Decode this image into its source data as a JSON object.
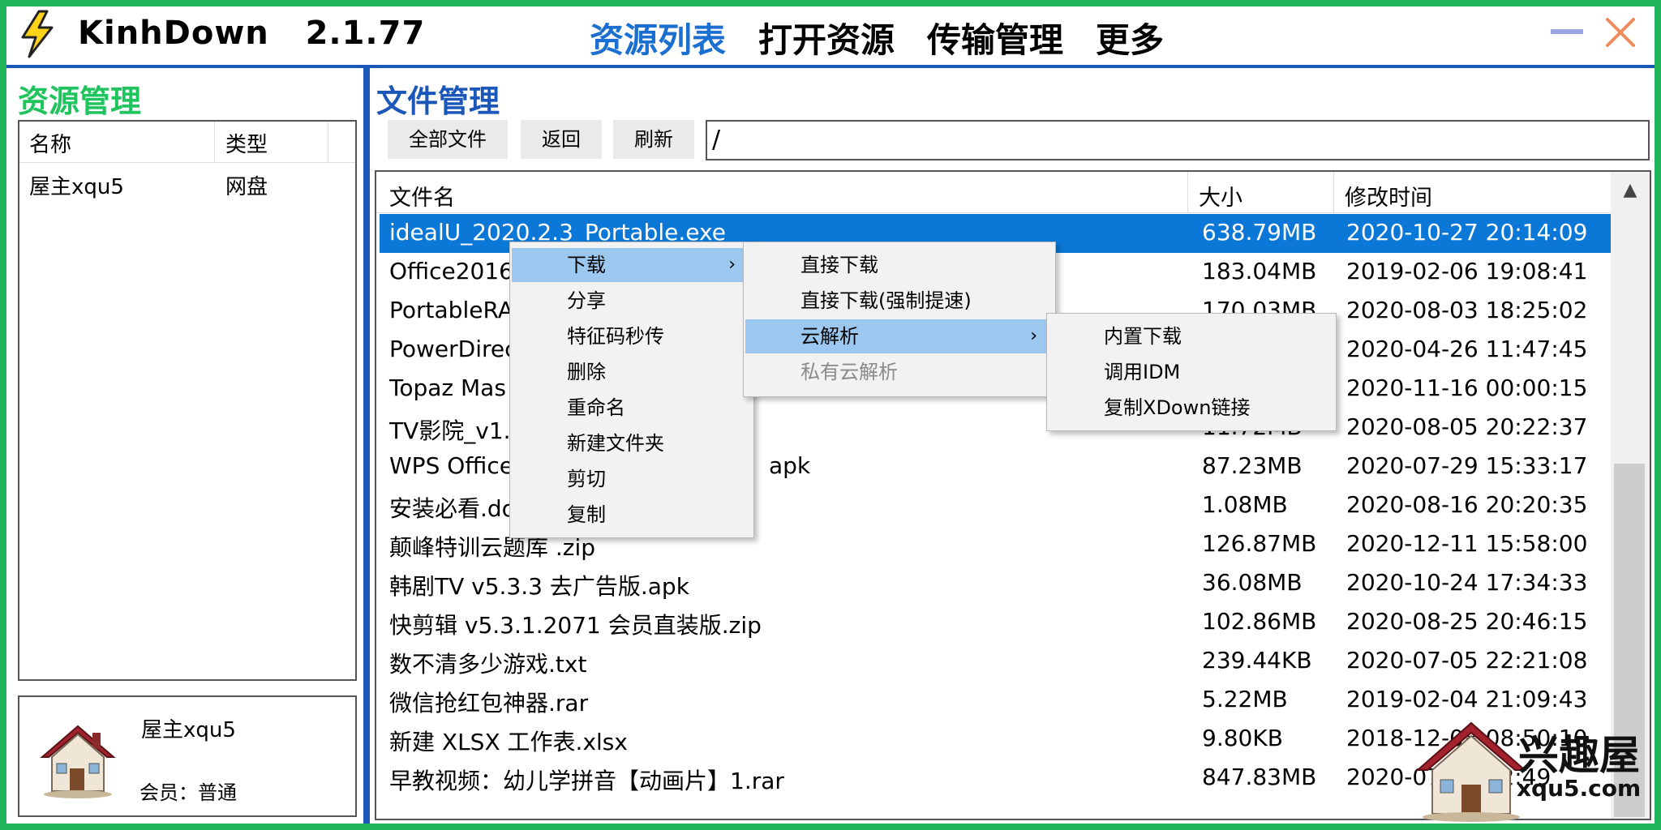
{
  "app": {
    "name": "KinhDown",
    "version": "2.1.77"
  },
  "nav": {
    "items": [
      "资源列表",
      "打开资源",
      "传输管理",
      "更多"
    ],
    "active": 0
  },
  "left": {
    "title": "资源管理",
    "columns": [
      "名称",
      "类型"
    ],
    "rows": [
      {
        "name": "屋主xqu5",
        "type": "网盘"
      }
    ],
    "user": {
      "name": "屋主xqu5",
      "level": "会员：普通"
    }
  },
  "right": {
    "title": "文件管理",
    "buttons": [
      "全部文件",
      "返回",
      "刷新"
    ],
    "path": "/",
    "columns": [
      "文件名",
      "大小",
      "修改时间"
    ],
    "files": [
      {
        "name": "idealU_2020.2.3_Portable.exe",
        "size": "638.79MB",
        "time": "2020-10-27 20:14:09"
      },
      {
        "name": "Office2016s",
        "size": "183.04MB",
        "time": "2019-02-06 19:08:41"
      },
      {
        "name": "PortableRA",
        "size": "170.03MB",
        "time": "2020-08-03 18:25:02"
      },
      {
        "name": "PowerDirec",
        "size": "",
        "time": "2020-04-26 11:47:45"
      },
      {
        "name": "Topaz Mas",
        "size": "",
        "time": "2020-11-16 00:00:15"
      },
      {
        "name": "TV影院_v1.5",
        "size": "11.72MB",
        "time": "2020-08-05 20:22:37"
      },
      {
        "name": "WPS Office",
        "name_tail": "apk",
        "size": "87.23MB",
        "time": "2020-07-29 15:33:17"
      },
      {
        "name": "安装必看.doc",
        "size": "1.08MB",
        "time": "2020-08-16 20:20:35"
      },
      {
        "name": "颠峰特训云题库 .zip",
        "size": "126.87MB",
        "time": "2020-12-11 15:58:00"
      },
      {
        "name": "韩剧TV v5.3.3 去广告版.apk",
        "size": "36.08MB",
        "time": "2020-10-24 17:34:33"
      },
      {
        "name": "快剪辑 v5.3.1.2071 会员直装版.zip",
        "size": "102.86MB",
        "time": "2020-08-25 20:46:15"
      },
      {
        "name": "数不清多少游戏.txt",
        "size": "239.44KB",
        "time": "2020-07-05 22:21:08"
      },
      {
        "name": "微信抢红包神器.rar",
        "size": "5.22MB",
        "time": "2019-02-04 21:09:43"
      },
      {
        "name": "新建 XLSX 工作表.xlsx",
        "size": "9.80KB",
        "time": "2018-12-08 08:50:10"
      },
      {
        "name": "早教视频：幼儿学拼音【动画片】1.rar",
        "size": "847.83MB",
        "time": "2020-07-02 22:49"
      }
    ]
  },
  "context_menu": {
    "items": [
      "下载",
      "分享",
      "特征码秒传",
      "删除",
      "重命名",
      "新建文件夹",
      "剪切",
      "复制"
    ],
    "download_submenu": [
      "直接下载",
      "直接下载(强制提速)",
      "云解析",
      "私有云解析"
    ],
    "cloud_submenu": [
      "内置下载",
      "调用IDM",
      "复制XDown链接"
    ]
  },
  "watermark": {
    "text": "兴趣屋",
    "url": "xqu5.com"
  },
  "colors": {
    "frame": "#1fb35a",
    "accent": "#1b57b8",
    "nav_active": "#1b6fd0",
    "selection": "#0b78d7",
    "menu_highlight": "#9cc8f0",
    "left_title": "#1fc45e"
  }
}
